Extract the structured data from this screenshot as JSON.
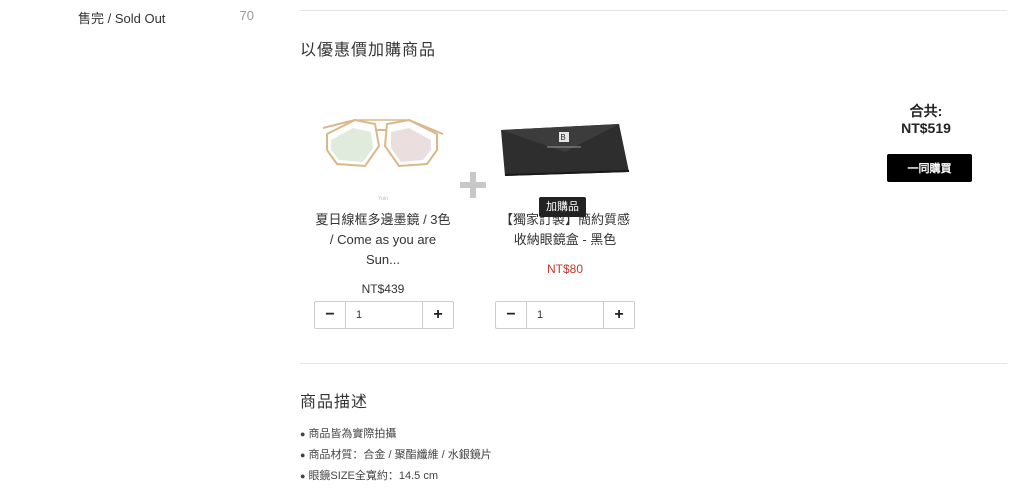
{
  "stock": {
    "label": "售完 / Sold Out",
    "count": "70"
  },
  "bundle": {
    "title": "以優惠價加購商品",
    "main_product": {
      "name_line1": "夏日線框多邊墨鏡 / 3色",
      "name_line2": "/ Come as you are Sun...",
      "price": "NT$439",
      "quantity": "1"
    },
    "addon_product": {
      "badge": "加購品",
      "name_line1": "【獨家訂製】簡約質感",
      "name_line2": "收納眼鏡盒 - 黑色",
      "price": "NT$80",
      "quantity": "1"
    },
    "total_label": "合共:",
    "total_amount": "NT$519",
    "buy_button": "一同購買"
  },
  "description": {
    "title": "商品描述",
    "items": [
      "商品皆為實際拍攝",
      "商品材質：合金 / 聚酯纖維 / 水銀鏡片",
      "眼鏡SIZE全寬約：14.5 cm"
    ]
  },
  "colors": {
    "addon_price": "#c0392b",
    "button_bg": "#000000"
  }
}
